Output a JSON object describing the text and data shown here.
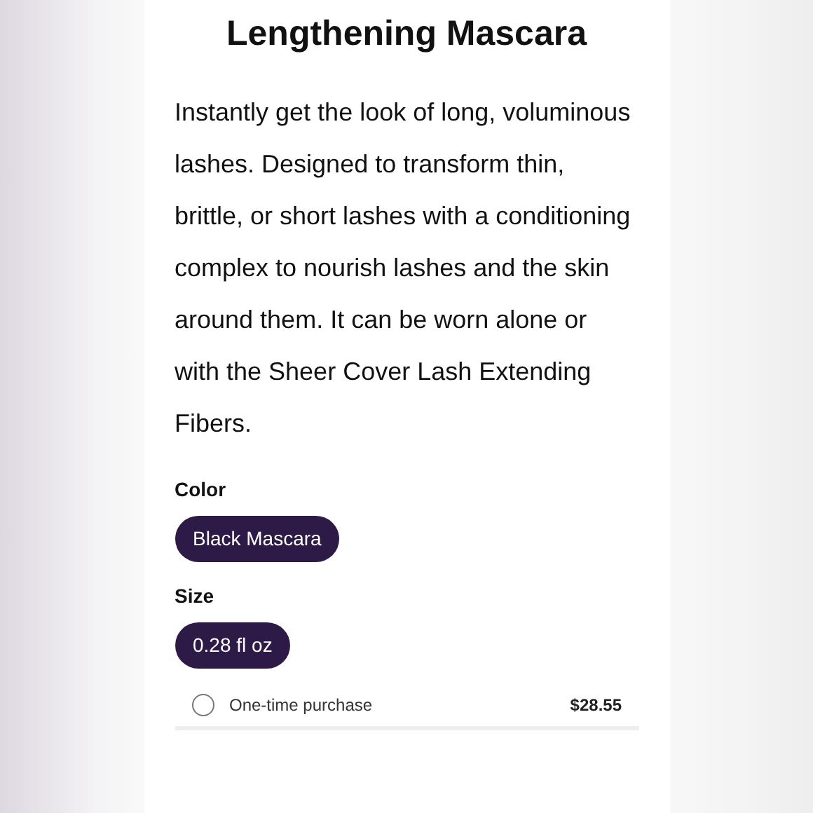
{
  "product": {
    "title": "Lengthening Mascara",
    "description": "Instantly get the look of long, voluminous lashes. Designed to transform thin, brittle, or short lashes with a conditioning complex to nourish lashes and the skin around them. It can be worn alone or with the Sheer Cover Lash Extending Fibers."
  },
  "option_groups": [
    {
      "label": "Color",
      "options": [
        {
          "label": "Black Mascara",
          "selected": true
        }
      ]
    },
    {
      "label": "Size",
      "options": [
        {
          "label": "0.28 fl oz",
          "selected": true
        }
      ]
    }
  ],
  "purchase_options": [
    {
      "label": "One-time purchase",
      "price": "$28.55",
      "selected": false
    }
  ]
}
